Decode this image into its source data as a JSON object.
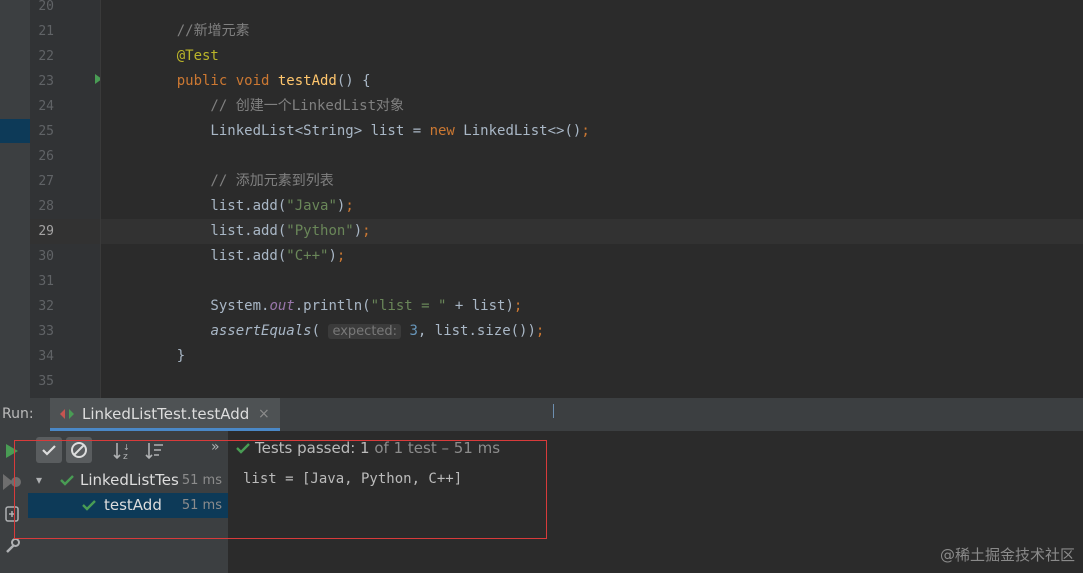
{
  "editor": {
    "lines": [
      {
        "num": "20",
        "tokens": []
      },
      {
        "num": "21",
        "tokens": [
          {
            "t": "    //新增元素",
            "c": "c-comment"
          }
        ]
      },
      {
        "num": "22",
        "tokens": [
          {
            "t": "    @Test",
            "c": "c-annot"
          }
        ]
      },
      {
        "num": "23",
        "tokens": [
          {
            "t": "    public void ",
            "c": "c-kw"
          },
          {
            "t": "testAdd",
            "c": "c-fn"
          },
          {
            "t": "() {",
            "c": ""
          }
        ]
      },
      {
        "num": "24",
        "tokens": [
          {
            "t": "        // 创建一个LinkedList对象",
            "c": "c-comment"
          }
        ]
      },
      {
        "num": "25",
        "tokens": [
          {
            "t": "        LinkedList<String> list = ",
            "c": ""
          },
          {
            "t": "new ",
            "c": "c-kw"
          },
          {
            "t": "LinkedList<>()",
            "c": ""
          },
          {
            "t": ";",
            "c": "c-kw"
          }
        ]
      },
      {
        "num": "26",
        "tokens": []
      },
      {
        "num": "27",
        "tokens": [
          {
            "t": "        // 添加元素到列表",
            "c": "c-comment"
          }
        ]
      },
      {
        "num": "28",
        "tokens": [
          {
            "t": "        list.add(",
            "c": ""
          },
          {
            "t": "\"Java\"",
            "c": "c-str"
          },
          {
            "t": ")",
            "c": ""
          },
          {
            "t": ";",
            "c": "c-kw"
          }
        ]
      },
      {
        "num": "29",
        "tokens": [
          {
            "t": "        list.add(",
            "c": ""
          },
          {
            "t": "\"Python\"",
            "c": "c-str"
          },
          {
            "t": ")",
            "c": ""
          },
          {
            "t": ";",
            "c": "c-kw"
          }
        ]
      },
      {
        "num": "30",
        "tokens": [
          {
            "t": "        list.add(",
            "c": ""
          },
          {
            "t": "\"C++\"",
            "c": "c-str"
          },
          {
            "t": ")",
            "c": ""
          },
          {
            "t": ";",
            "c": "c-kw"
          }
        ]
      },
      {
        "num": "31",
        "tokens": []
      },
      {
        "num": "32",
        "tokens": [
          {
            "t": "        System.",
            "c": ""
          },
          {
            "t": "out",
            "c": "c-field"
          },
          {
            "t": ".println(",
            "c": ""
          },
          {
            "t": "\"list = \"",
            "c": "c-str"
          },
          {
            "t": " + list)",
            "c": ""
          },
          {
            "t": ";",
            "c": "c-kw"
          }
        ]
      },
      {
        "num": "33",
        "tokens": [
          {
            "t": "        ",
            "c": ""
          },
          {
            "t": "assertEquals",
            "c": "c-italic"
          },
          {
            "t": "( ",
            "c": ""
          },
          {
            "t": "expected:",
            "c": "hint"
          },
          {
            "t": " 3",
            "c": "c-num"
          },
          {
            "t": ", list.size())",
            "c": ""
          },
          {
            "t": ";",
            "c": "c-kw"
          }
        ]
      },
      {
        "num": "34",
        "tokens": [
          {
            "t": "    }",
            "c": ""
          }
        ]
      },
      {
        "num": "35",
        "tokens": []
      }
    ],
    "current_line": "29"
  },
  "run": {
    "label": "Run:",
    "tab_title": "LinkedListTest.testAdd",
    "tab_close": "×"
  },
  "tests": {
    "status_prefix": "Tests passed: ",
    "status_count": "1",
    "status_suffix": " of 1 test – 51 ms",
    "expand_chevron": "»",
    "tree": [
      {
        "label": "LinkedListTes",
        "time": "51 ms"
      },
      {
        "label": "testAdd",
        "time": "51 ms"
      }
    ]
  },
  "output": {
    "text": "list = [Java, Python, C++]"
  },
  "watermark": "@稀土掘金技术社区",
  "colors": {
    "accent": "#499c54",
    "selection": "#0d3a58",
    "highlight_box": "#d83b3b"
  }
}
